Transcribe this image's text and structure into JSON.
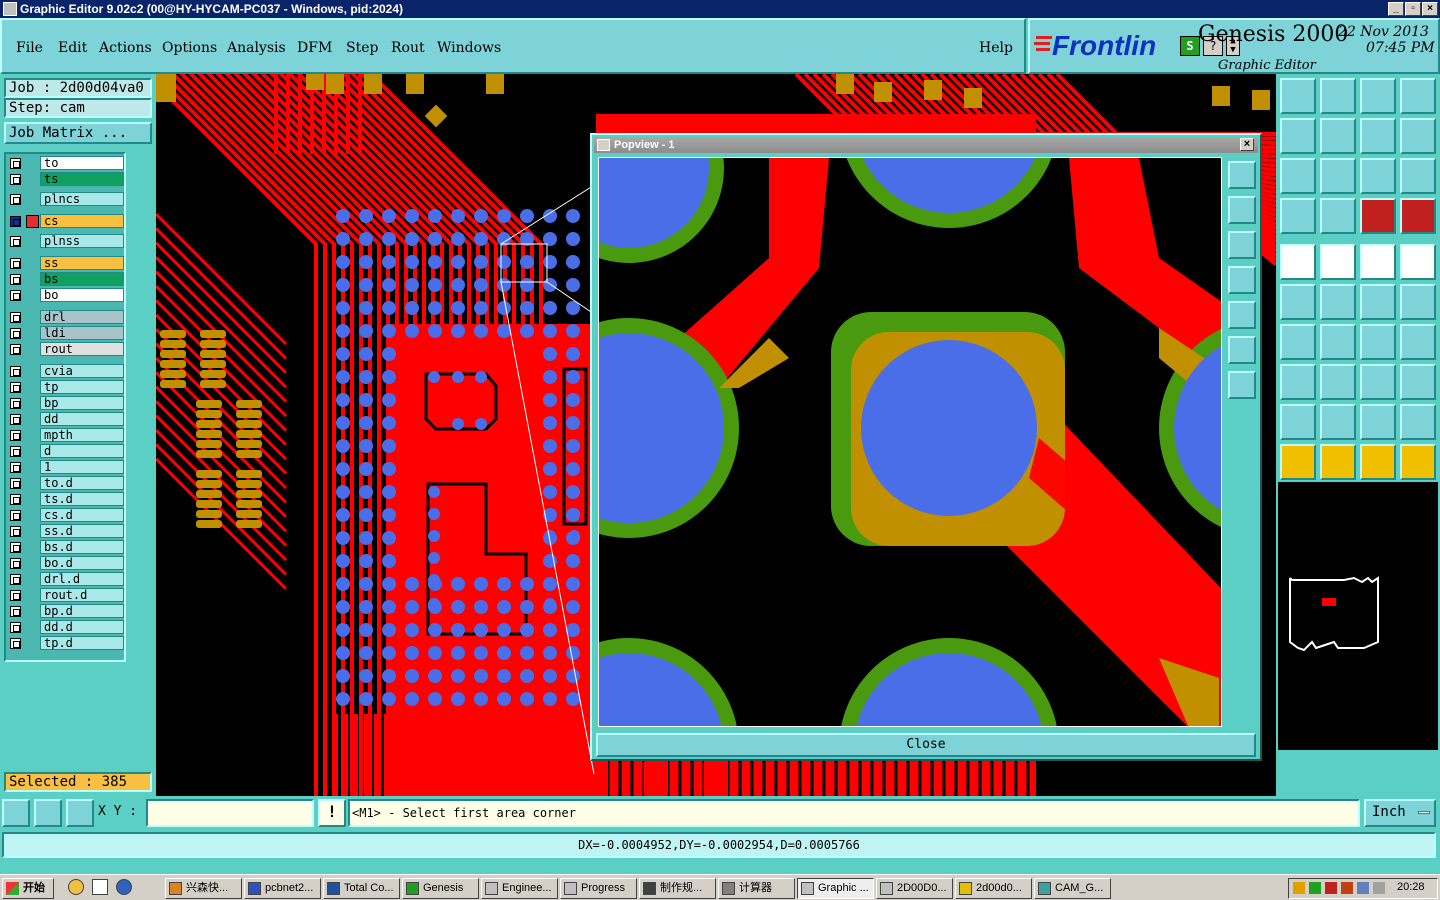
{
  "window": {
    "title": "Graphic Editor 9.02c2 (00@HY-HYCAM-PC037 - Windows, pid:2024)"
  },
  "menu": [
    "File",
    "Edit",
    "Actions",
    "Options",
    "Analysis",
    "DFM",
    "Step",
    "Rout",
    "Windows"
  ],
  "help": "Help",
  "brand": {
    "logo": "Frontlin",
    "product": "Genesis 2000",
    "subtitle": "Graphic Editor",
    "date": "22 Nov 2013",
    "time": "07:45 PM"
  },
  "job": {
    "job_label": "Job : 2d00d04va0",
    "step_label": "Step: cam",
    "matrix_button": "Job Matrix ..."
  },
  "layers": [
    {
      "name": "to",
      "color": "#ffffff"
    },
    {
      "name": "ts",
      "color": "#10a060"
    },
    {
      "name": "plncs",
      "color": "#a8e8e8"
    },
    {
      "name": "cs",
      "color": "#f8c040"
    },
    {
      "name": "plnss",
      "color": "#a8e8e8"
    },
    {
      "name": "ss",
      "color": "#f8c040"
    },
    {
      "name": "bs",
      "color": "#10a060"
    },
    {
      "name": "bo",
      "color": "#ffffff"
    },
    {
      "name": "drl",
      "color": "#a8c4c8"
    },
    {
      "name": "ldi",
      "color": "#a8c4c8"
    },
    {
      "name": "rout",
      "color": "#e0e0e0"
    },
    {
      "name": "cvia",
      "color": "#a8e8e8"
    },
    {
      "name": "tp",
      "color": "#a8e8e8"
    },
    {
      "name": "bp",
      "color": "#a8e8e8"
    },
    {
      "name": "dd",
      "color": "#a8e8e8"
    },
    {
      "name": "mpth",
      "color": "#a8e8e8"
    },
    {
      "name": "d",
      "color": "#a8e8e8"
    },
    {
      "name": "1",
      "color": "#a8e8e8"
    },
    {
      "name": "to.d",
      "color": "#a8e8e8"
    },
    {
      "name": "ts.d",
      "color": "#a8e8e8"
    },
    {
      "name": "cs.d",
      "color": "#a8e8e8"
    },
    {
      "name": "ss.d",
      "color": "#a8e8e8"
    },
    {
      "name": "bs.d",
      "color": "#a8e8e8"
    },
    {
      "name": "bo.d",
      "color": "#a8e8e8"
    },
    {
      "name": "drl.d",
      "color": "#a8e8e8"
    },
    {
      "name": "rout.d",
      "color": "#a8e8e8"
    },
    {
      "name": "bp.d",
      "color": "#a8e8e8"
    },
    {
      "name": "dd.d",
      "color": "#a8e8e8"
    },
    {
      "name": "tp.d",
      "color": "#a8e8e8"
    }
  ],
  "selected": "Selected : 385",
  "popview": {
    "title": "Popview - 1",
    "close_label": "Close"
  },
  "command": {
    "xy_label": "X Y :",
    "xy_value": "",
    "prompt": "<M1> - Select first area corner",
    "units": "Inch"
  },
  "status": "DX=-0.0004952,DY=-0.0002954,D=0.0005766",
  "taskbar": {
    "start": "开始",
    "tasks": [
      "兴森快...",
      "pcbnet2...",
      "Total Co...",
      "Genesis",
      "Enginee...",
      "Progress",
      "制作规...",
      "计算器",
      "Graphic ...",
      "2D00D0...",
      "2d00d0...",
      "CAM_G..."
    ],
    "clock": "20:28"
  },
  "colors": {
    "copper": "#ff0000",
    "pad": "#4a6ee8",
    "mask": "#4a9a10",
    "overlap": "#c09000",
    "canvas": "#000000",
    "panel": "#5bcfc3"
  }
}
